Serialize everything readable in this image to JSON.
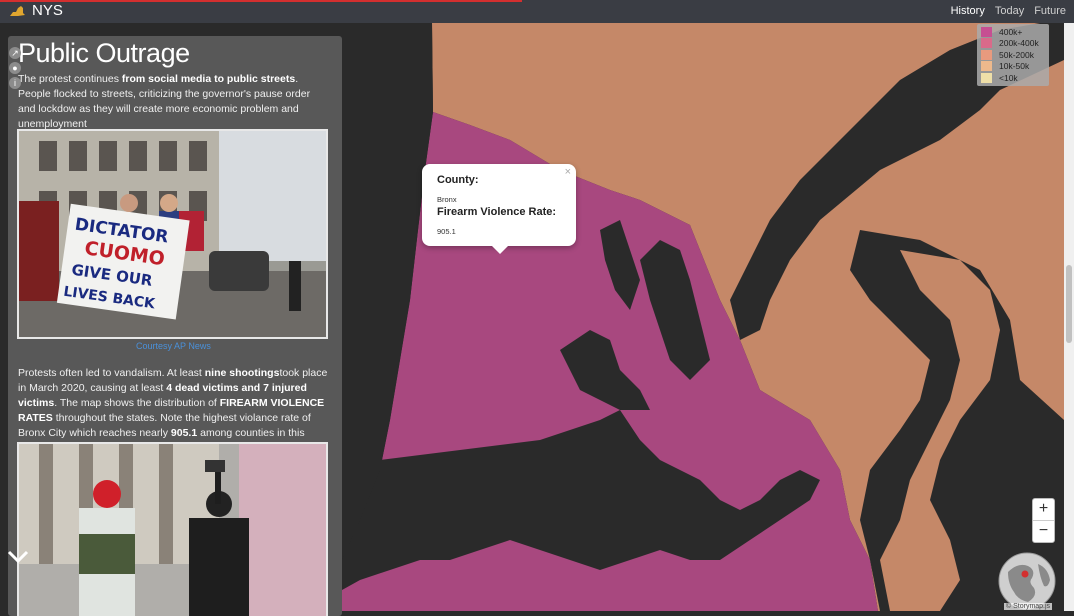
{
  "header": {
    "brand": "NYS",
    "nav": [
      "History",
      "Today",
      "Future"
    ],
    "active_nav": "History"
  },
  "sidebar": {
    "title": "Public Outrage",
    "icons": [
      "share-icon",
      "github-icon",
      "info-icon"
    ],
    "paragraph1": {
      "t1": "The protest continues ",
      "b1": "from social media to public streets",
      "t2": ". People flocked to streets, criticizing the governor's pause order and lockdow as they will create more economic problem and unemployment"
    },
    "photo1": {
      "sign_line1": "DICTATOR",
      "sign_line2": "CUOMO",
      "sign_line3": "GIVE OUR",
      "sign_line4": "LIVES BACK"
    },
    "credit": "Courtesy AP News",
    "paragraph2": {
      "t1": "Protests often led to vandalism. At least ",
      "b1": "nine shootings",
      "t2": "took place in March 2020, causing at least ",
      "b2": "4 dead victims and 7 injured victims",
      "t3": ". The map shows the distribution of ",
      "b3": "FIREARM VIOLENCE RATES",
      "t4": " throughout the states. Note the highest violance rate of Bronx City which reaches nearly ",
      "b4": "905.1",
      "t5": " among counties in this state."
    }
  },
  "legend": {
    "items": [
      {
        "label": "400k+",
        "color": "#c64f92"
      },
      {
        "label": "200k-400k",
        "color": "#d96a8a"
      },
      {
        "label": "50k-200k",
        "color": "#e89a7e"
      },
      {
        "label": "10k-50k",
        "color": "#edb98c"
      },
      {
        "label": "<10k",
        "color": "#eedfa8"
      }
    ]
  },
  "popup": {
    "county_label": "County:",
    "county_value": "Bronx",
    "rate_label": "Firearm Violence Rate:",
    "rate_value": "905.1",
    "close": "×"
  },
  "zoom": {
    "in": "+",
    "out": "−"
  },
  "attribution": "© Storymap.js",
  "colors": {
    "bronx": "#a8487f",
    "neighbor": "#c58868",
    "water": "#2a2a2a",
    "header": "#3a3d44",
    "progress": "#d32f2f"
  }
}
